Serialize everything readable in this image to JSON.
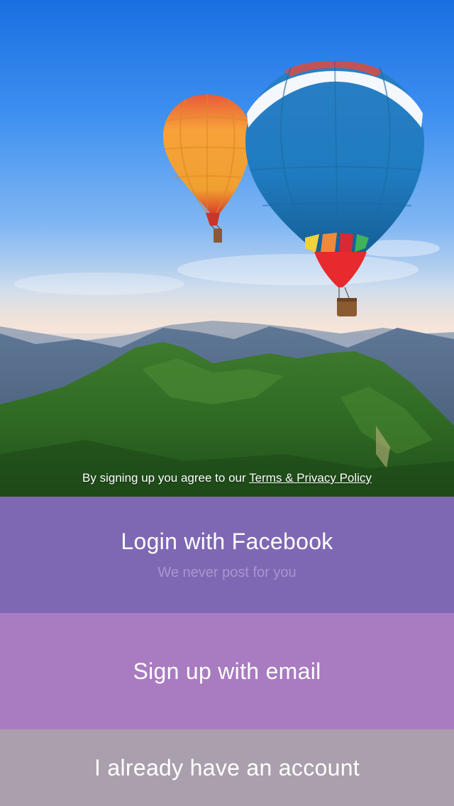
{
  "hero": {
    "image": "hot-air-balloons-over-mountains",
    "terms_prefix": "By signing up you agree to our ",
    "terms_link": "Terms & Privacy Policy"
  },
  "buttons": {
    "facebook": {
      "label": "Login with Facebook",
      "sublabel": "We never post for you",
      "color": "#7f68b3"
    },
    "email": {
      "label": "Sign up with email",
      "color": "#a97bc0"
    },
    "existing": {
      "label": "I already have an account",
      "color": "#aa9fad"
    }
  }
}
